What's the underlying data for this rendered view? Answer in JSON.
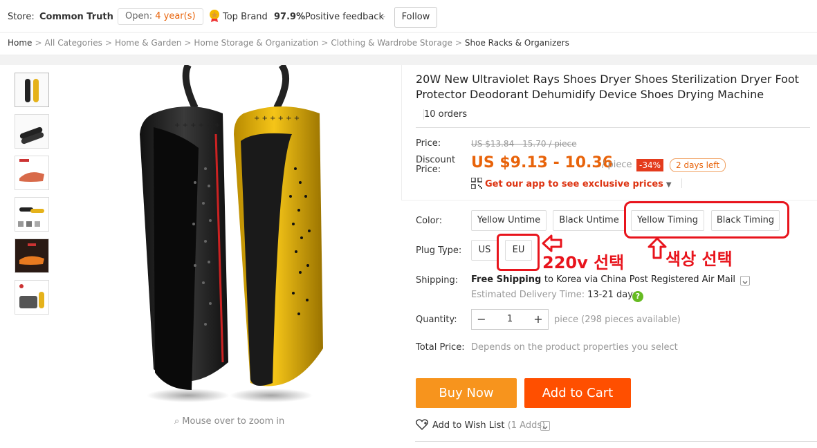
{
  "store": {
    "label": "Store:",
    "name": "Common Truth",
    "open_label": "Open:",
    "open_value": "4 year(s)",
    "top_brand": "Top Brand",
    "feedback_pct": "97.9%",
    "feedback_label": "Positive feedback",
    "follow": "Follow"
  },
  "breadcrumb": [
    "Home",
    "All Categories",
    "Home & Garden",
    "Home Storage & Organization",
    "Clothing & Wardrobe Storage",
    "Shoe Racks & Organizers"
  ],
  "gallery": {
    "zoom_hint": "Mouse over to zoom in"
  },
  "product": {
    "title": "20W New Ultraviolet Rays Shoes Dryer Shoes Sterilization Dryer Foot Protector Deodorant Dehumidify Device Shoes Drying Machine",
    "orders": "10 orders"
  },
  "price": {
    "label": "Price:",
    "original": "US $13.84 - 15.70 / piece",
    "discount_label_1": "Discount",
    "discount_label_2": "Price:",
    "current": "US $9.13 - 10.36",
    "per_piece": "/ piece",
    "discount_badge": "-34%",
    "days_left": "2 days left",
    "app_promo": "Get our app to see exclusive prices"
  },
  "options": {
    "color_label": "Color:",
    "colors": [
      "Yellow Untime",
      "Black Untime",
      "Yellow Timing",
      "Black Timing"
    ],
    "plug_label": "Plug Type:",
    "plugs": [
      "US",
      "EU"
    ]
  },
  "annotations": {
    "plug_note": "220v 선택",
    "color_note": "색상 선택"
  },
  "shipping": {
    "label": "Shipping:",
    "free": "Free Shipping",
    "to": "to Korea via China Post Registered Air Mail",
    "est_label": "Estimated Delivery Time:",
    "est_days": "13-21 days"
  },
  "quantity": {
    "label": "Quantity:",
    "value": "1",
    "available": "piece (298 pieces available)"
  },
  "total": {
    "label": "Total Price:",
    "value": "Depends on the product properties you select"
  },
  "actions": {
    "buy_now": "Buy Now",
    "add_to_cart": "Add to Cart",
    "wish": "Add to Wish List",
    "wish_count": "(1 Adds)"
  },
  "colors": {
    "accent_orange": "#e8630a",
    "buy_now_bg": "#f7941d",
    "add_cart_bg": "#ff4f00",
    "annotation_red": "#e8141c"
  }
}
